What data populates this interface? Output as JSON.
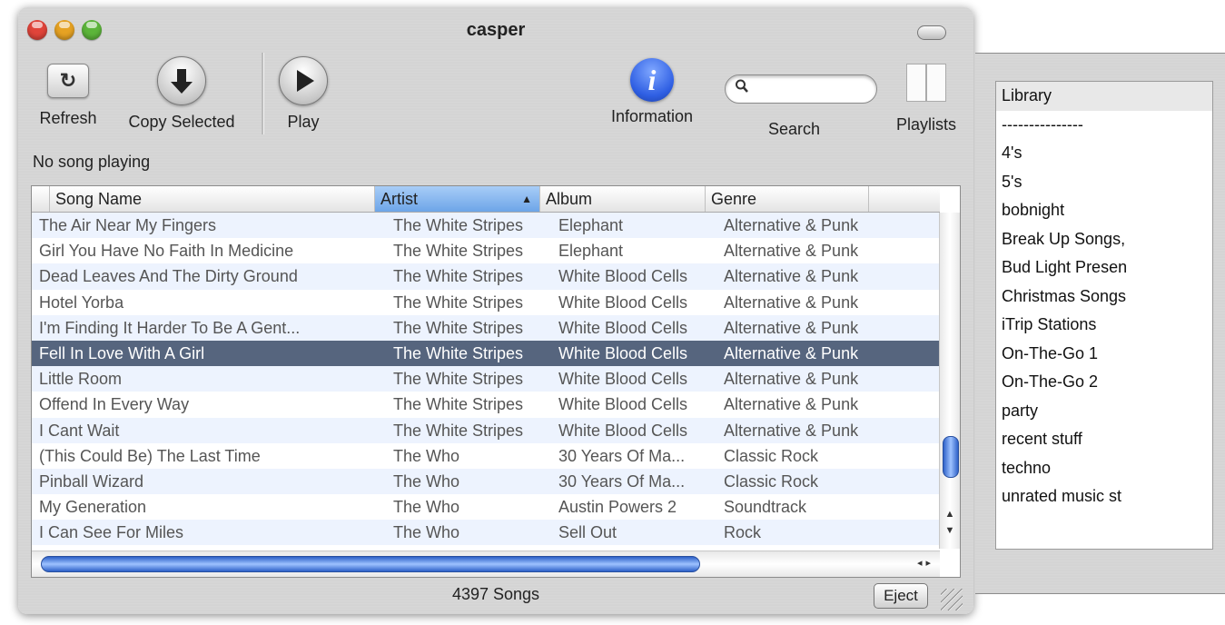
{
  "window": {
    "title": "casper"
  },
  "toolbar": {
    "refresh_label": "Refresh",
    "refresh_icon": "refresh-icon",
    "copy_label": "Copy Selected",
    "copy_icon": "download-arrow-icon",
    "play_label": "Play",
    "play_icon": "play-icon",
    "info_label": "Information",
    "info_glyph": "i",
    "search_label": "Search",
    "search_placeholder": "",
    "playlists_label": "Playlists"
  },
  "status": {
    "text": "No song playing"
  },
  "table": {
    "columns": [
      "Song Name",
      "Artist",
      "Album",
      "Genre"
    ],
    "sorted_column": "Artist",
    "rows": [
      [
        "The Air Near My Fingers",
        "The White Stripes",
        "Elephant",
        "Alternative & Punk"
      ],
      [
        "Girl You Have No Faith In Medicine",
        "The White Stripes",
        "Elephant",
        "Alternative & Punk"
      ],
      [
        "Dead Leaves And The Dirty Ground",
        "The White Stripes",
        "White Blood Cells",
        "Alternative & Punk"
      ],
      [
        "Hotel Yorba",
        "The White Stripes",
        "White Blood Cells",
        "Alternative & Punk"
      ],
      [
        "I'm Finding It Harder To Be A Gent...",
        "The White Stripes",
        "White Blood Cells",
        "Alternative & Punk"
      ],
      [
        "Fell In Love With A Girl",
        "The White Stripes",
        "White Blood Cells",
        "Alternative & Punk"
      ],
      [
        "Little Room",
        "The White Stripes",
        "White Blood Cells",
        "Alternative & Punk"
      ],
      [
        "Offend In Every Way",
        "The White Stripes",
        "White Blood Cells",
        "Alternative & Punk"
      ],
      [
        "I Cant Wait",
        "The White Stripes",
        "White Blood Cells",
        "Alternative & Punk"
      ],
      [
        "(This Could Be) The Last Time",
        "The Who",
        "30 Years Of Ma...",
        "Classic Rock"
      ],
      [
        "Pinball Wizard",
        "The Who",
        "30 Years Of Ma...",
        "Classic Rock"
      ],
      [
        "My Generation",
        "The Who",
        "Austin Powers 2",
        "Soundtrack"
      ],
      [
        "I Can See For Miles",
        "The Who",
        "Sell Out",
        "Rock"
      ]
    ],
    "selected_row": 5
  },
  "footer": {
    "song_count": "4397 Songs",
    "eject_label": "Eject"
  },
  "playlists": {
    "items": [
      "Library",
      "---------------",
      "4's",
      "5's",
      "bobnight",
      "Break Up Songs,",
      "Bud Light Presen",
      "Christmas Songs",
      "iTrip Stations",
      "On-The-Go 1",
      "On-The-Go 2",
      "party",
      "recent stuff",
      "techno",
      "unrated music st"
    ]
  },
  "colors": {
    "selected_row": "#56657e",
    "alt_row": "#edf3fe",
    "sorted_header": "#6da5e8",
    "scroll_thumb": "#2c60c8"
  }
}
